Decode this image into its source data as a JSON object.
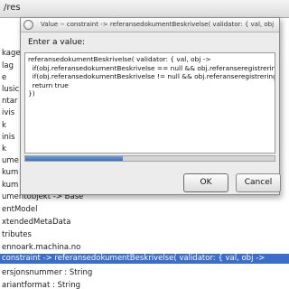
{
  "background": {
    "path_text": "/res",
    "tree_rows": [
      "",
      "",
      "kage",
      "lag",
      "e",
      "lusic",
      "ntar",
      "ivis",
      "k",
      "inis",
      "k",
      "ume",
      "kum",
      "kum",
      "umentobjekt -> Base",
      "entModel",
      "xtendedMetaData",
      "tributes",
      "ennoark.machina.no",
      "constraint -> referansedokumentBeskrivelse( validator: { val, obj ->",
      "ersjonsnummer : String",
      "ariantformat : String"
    ],
    "selected_index": 19
  },
  "dialog": {
    "title": "Value -- constraint -> referansedokumentBeskrivelse( validator: { val, obj -> ...",
    "prompt": "Enter a value:",
    "code": "referansedokumentBeskrivelse( validator: { val, obj ->\n  if(obj.referansedokumentBeskrivelse == null && obj.referanseregistrering ==\n  if(obj.referansedokumentBeskrivelse != null && obj.referanseregistrering !=\n  return true\n})",
    "progress_fraction": 0.39,
    "ok_label": "OK",
    "cancel_label": "Cancel"
  }
}
